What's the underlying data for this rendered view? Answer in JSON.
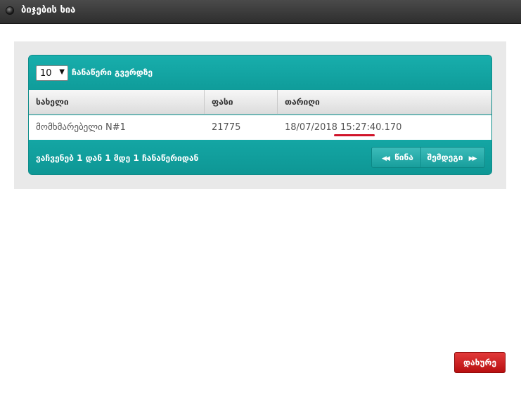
{
  "window": {
    "title": "ბიჯების ხია"
  },
  "grid": {
    "per_page": {
      "value": "10",
      "label": "ჩანაწერი გვერდზე"
    },
    "columns": [
      "სახელი",
      "ფასი",
      "თარიღი"
    ],
    "rows": [
      {
        "name": "მომხმარებელი N#1",
        "price": "21775",
        "date": "18/07/2018 15:27:40.170"
      }
    ],
    "info": "ვაჩვენებ 1 დან 1 მდე 1 ჩანაწერიდან",
    "pager": {
      "prev_label": "წინა",
      "next_label": "შემდეგი"
    }
  },
  "footer": {
    "close_label": "დახურე"
  },
  "colors": {
    "teal": "#13a3a1",
    "close_red": "#c8181a",
    "annotation_red": "#d0142a"
  }
}
